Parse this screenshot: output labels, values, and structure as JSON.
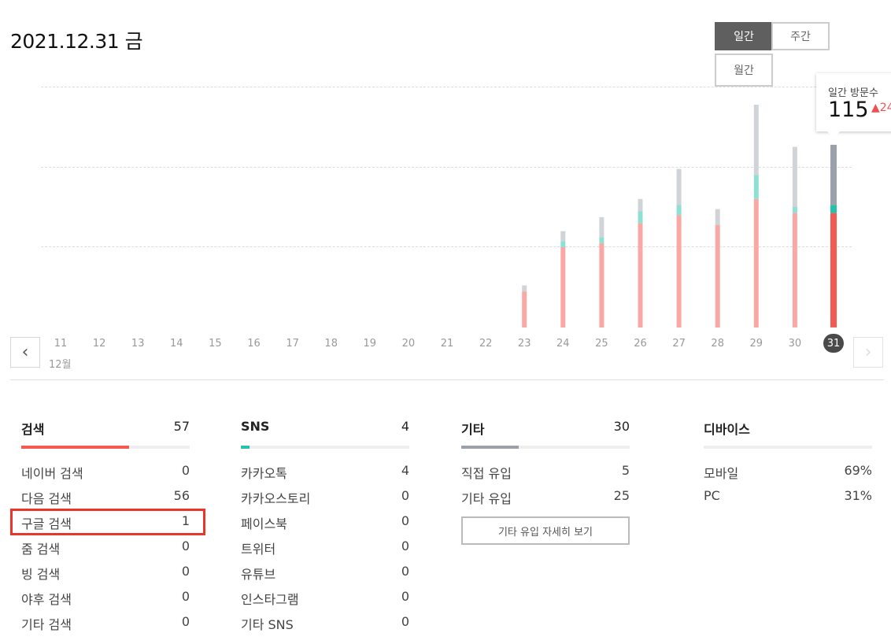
{
  "date_title": "2021.12.31 금",
  "period_tabs": [
    {
      "label": "일간",
      "active": true
    },
    {
      "label": "주간",
      "active": false
    },
    {
      "label": "월간",
      "active": false
    }
  ],
  "tooltip": {
    "label": "일간 방문수",
    "value": "115",
    "delta": "24"
  },
  "month_label": "12월",
  "nav": {
    "prev_icon": "chevron-left-icon",
    "next_icon": "chevron-right-icon"
  },
  "chart_data": {
    "type": "bar",
    "stacked": true,
    "categories": [
      "11",
      "12",
      "13",
      "14",
      "15",
      "16",
      "17",
      "18",
      "19",
      "20",
      "21",
      "22",
      "23",
      "24",
      "25",
      "26",
      "27",
      "28",
      "29",
      "30",
      "31"
    ],
    "selected": "31",
    "series": [
      {
        "name": "검색",
        "color": "#f9a8a4",
        "selected_color": "#f25a52",
        "values": [
          0,
          0,
          0,
          0,
          0,
          0,
          0,
          0,
          0,
          0,
          0,
          0,
          18,
          40,
          42,
          52,
          56,
          51,
          64,
          57,
          57
        ]
      },
      {
        "name": "SNS",
        "color": "#8ee0d2",
        "selected_color": "#25c2a9",
        "values": [
          0,
          0,
          0,
          0,
          0,
          0,
          0,
          0,
          0,
          0,
          0,
          0,
          0,
          3,
          3,
          6,
          5,
          0,
          12,
          3,
          4
        ]
      },
      {
        "name": "기타",
        "color": "#d0d4d9",
        "selected_color": "#9aa1ab",
        "values": [
          0,
          0,
          0,
          0,
          0,
          0,
          0,
          0,
          0,
          0,
          0,
          0,
          3,
          5,
          10,
          6,
          18,
          8,
          35,
          30,
          30
        ]
      }
    ],
    "ylim": [
      0,
      120
    ],
    "grid": true
  },
  "stats": [
    {
      "label": "검색",
      "total": "57",
      "bar_color": "#f25a52",
      "fill": 0.64,
      "rows": [
        {
          "label": "네이버 검색",
          "value": "0"
        },
        {
          "label": "다음 검색",
          "value": "56"
        },
        {
          "label": "구글 검색",
          "value": "1"
        },
        {
          "label": "줌 검색",
          "value": "0"
        },
        {
          "label": "빙 검색",
          "value": "0"
        },
        {
          "label": "야후 검색",
          "value": "0"
        },
        {
          "label": "기타 검색",
          "value": "0"
        }
      ]
    },
    {
      "label": "SNS",
      "total": "4",
      "bar_color": "#25c2a9",
      "fill": 0.05,
      "rows": [
        {
          "label": "카카오톡",
          "value": "4"
        },
        {
          "label": "카카오스토리",
          "value": "0"
        },
        {
          "label": "페이스북",
          "value": "0"
        },
        {
          "label": "트위터",
          "value": "0"
        },
        {
          "label": "유튜브",
          "value": "0"
        },
        {
          "label": "인스타그램",
          "value": "0"
        },
        {
          "label": "기타 SNS",
          "value": "0"
        }
      ]
    },
    {
      "label": "기타",
      "total": "30",
      "bar_color": "#9aa1ab",
      "fill": 0.34,
      "rows": [
        {
          "label": "직접 유입",
          "value": "5"
        },
        {
          "label": "기타 유입",
          "value": "25"
        }
      ],
      "button_label": "기타 유입 자세히 보기"
    },
    {
      "label": "디바이스",
      "total": "",
      "bar_color": "#9aa1ab",
      "fill": 0,
      "rows": [
        {
          "label": "모바일",
          "value": "69%"
        },
        {
          "label": "PC",
          "value": "31%"
        }
      ]
    }
  ]
}
